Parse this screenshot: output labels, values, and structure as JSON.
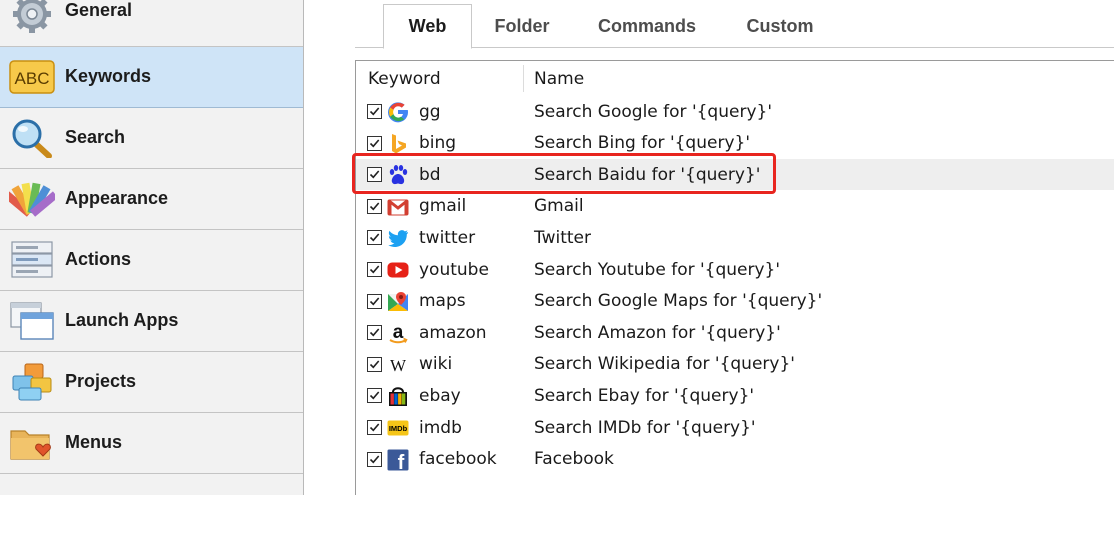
{
  "sidebar": {
    "items": [
      {
        "label": "General",
        "icon": "gear-icon",
        "active": false
      },
      {
        "label": "Keywords",
        "icon": "abc-icon",
        "icon_text": "ABC",
        "active": true
      },
      {
        "label": "Search",
        "icon": "magnifier-icon",
        "active": false
      },
      {
        "label": "Appearance",
        "icon": "color-swatch-icon",
        "active": false
      },
      {
        "label": "Actions",
        "icon": "actions-list-icon",
        "active": false
      },
      {
        "label": "Launch Apps",
        "icon": "windows-icon",
        "active": false
      },
      {
        "label": "Projects",
        "icon": "blocks-icon",
        "active": false
      },
      {
        "label": "Menus",
        "icon": "folder-heart-icon",
        "active": false
      }
    ]
  },
  "tabs": [
    {
      "label": "Web",
      "active": true
    },
    {
      "label": "Folder",
      "active": false
    },
    {
      "label": "Commands",
      "active": false
    },
    {
      "label": "Custom",
      "active": false
    }
  ],
  "table": {
    "columns": [
      "Keyword",
      "Name"
    ],
    "rows": [
      {
        "keyword": "gg",
        "name": "Search Google for '{query}'",
        "icon": "google-icon",
        "checked": true
      },
      {
        "keyword": "bing",
        "name": "Search Bing for '{query}'",
        "icon": "bing-icon",
        "checked": true
      },
      {
        "keyword": "bd",
        "name": "Search Baidu for '{query}'",
        "icon": "baidu-icon",
        "checked": true,
        "highlighted": true
      },
      {
        "keyword": "gmail",
        "name": "Gmail",
        "icon": "gmail-icon",
        "checked": true
      },
      {
        "keyword": "twitter",
        "name": "Twitter",
        "icon": "twitter-icon",
        "checked": true
      },
      {
        "keyword": "youtube",
        "name": "Search Youtube for '{query}'",
        "icon": "youtube-icon",
        "checked": true
      },
      {
        "keyword": "maps",
        "name": "Search Google Maps for '{query}'",
        "icon": "maps-icon",
        "checked": true
      },
      {
        "keyword": "amazon",
        "name": "Search Amazon for '{query}'",
        "icon": "amazon-icon",
        "icon_text": "a",
        "checked": true
      },
      {
        "keyword": "wiki",
        "name": "Search Wikipedia for '{query}'",
        "icon": "wikipedia-icon",
        "icon_text": "W",
        "checked": true
      },
      {
        "keyword": "ebay",
        "name": "Search Ebay for '{query}'",
        "icon": "ebay-icon",
        "checked": true
      },
      {
        "keyword": "imdb",
        "name": "Search IMDb for '{query}'",
        "icon": "imdb-icon",
        "icon_text": "IMDb",
        "checked": true
      },
      {
        "keyword": "facebook",
        "name": "Facebook",
        "icon": "facebook-icon",
        "icon_text": "f",
        "checked": true
      }
    ]
  },
  "colors": {
    "sidebar_active": "#cfe4f7",
    "highlight": "#e8251f",
    "selected_row": "#eeeeee"
  }
}
